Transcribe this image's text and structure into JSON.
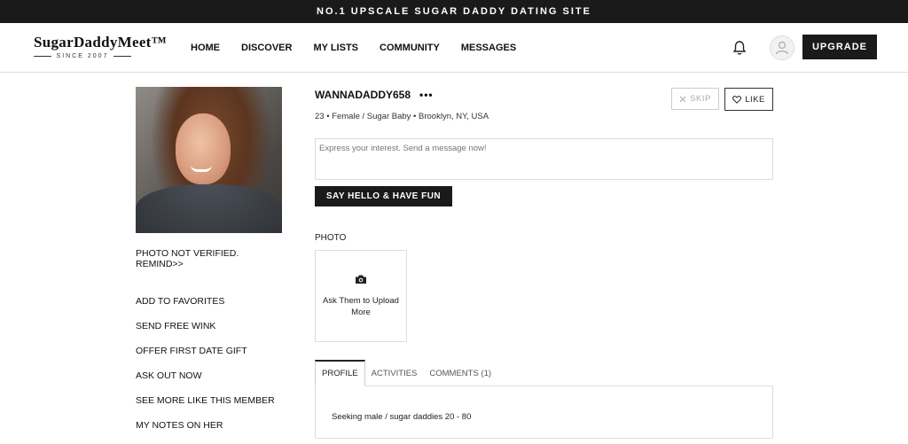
{
  "topbar": {
    "text": "NO.1 UPSCALE SUGAR DADDY DATING SITE"
  },
  "logo": {
    "main": "SugarDaddyMeet™",
    "sub": "SINCE 2007"
  },
  "nav": {
    "items": [
      {
        "label": "HOME"
      },
      {
        "label": "DISCOVER"
      },
      {
        "label": "MY LISTS"
      },
      {
        "label": "COMMUNITY"
      },
      {
        "label": "MESSAGES"
      }
    ],
    "upgrade_label": "UPGRADE"
  },
  "profile": {
    "username": "WANNADADDY658",
    "more": "•••",
    "meta": "23 • Female / Sugar Baby • Brooklyn, NY, USA",
    "photo_note": "PHOTO NOT VERIFIED. REMIND>>",
    "skip_label": "SKIP",
    "like_label": "LIKE"
  },
  "actions": [
    {
      "label": "ADD TO FAVORITES"
    },
    {
      "label": "SEND FREE WINK"
    },
    {
      "label": "OFFER FIRST DATE GIFT"
    },
    {
      "label": "ASK OUT NOW"
    },
    {
      "label": "SEE MORE LIKE THIS MEMBER"
    },
    {
      "label": "MY NOTES ON HER"
    }
  ],
  "message": {
    "placeholder": "Express your interest. Send a message now!",
    "button_label": "SAY HELLO & HAVE FUN"
  },
  "photo_section": {
    "label": "PHOTO",
    "upload_text": "Ask Them to Upload More"
  },
  "tabs": [
    {
      "label": "PROFILE",
      "active": true
    },
    {
      "label": "ACTIVITIES",
      "active": false
    },
    {
      "label": "COMMENTS (1)",
      "active": false
    }
  ],
  "profile_tab": {
    "seeking": "Seeking male / sugar daddies 20 - 80"
  },
  "colors": {
    "dark": "#1a1a1a",
    "border": "#dddddd"
  },
  "icons": [
    "bell-icon",
    "user-icon",
    "close-icon",
    "heart-icon",
    "camera-icon"
  ]
}
